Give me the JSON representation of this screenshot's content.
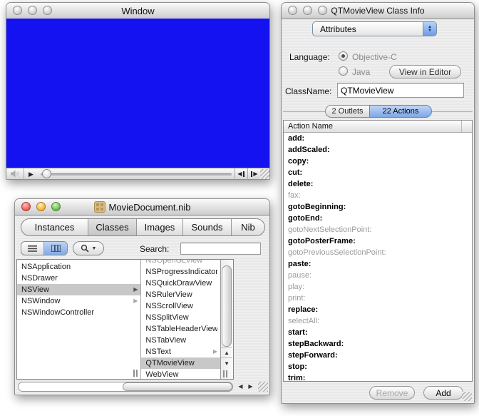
{
  "colors": {
    "movie_blue": "#1512f2",
    "selection_gray": "#c8c8c8",
    "selected_tab_blue": "#8fb3ec",
    "window_chrome": "#ececec"
  },
  "icons": {
    "play": "▶",
    "step_back_triangle": "◀",
    "step_fwd_triangle": "▶",
    "up_arrow": "▲",
    "down_arrow": "▼",
    "left_arrow": "◀",
    "right_arrow": "▶",
    "branch_arrow": "▶",
    "popup_up": "▲",
    "popup_down": "▼",
    "dropdown_arrow": "▼"
  },
  "movie_window": {
    "title": "Window"
  },
  "nib_window": {
    "title": "MovieDocument.nib",
    "tabs": [
      "Instances",
      "Classes",
      "Images",
      "Sounds",
      "Nib"
    ],
    "selected_tab": "Classes",
    "search_label": "Search:",
    "search_value": "",
    "browser": {
      "col1": [
        {
          "label": "NSApplication"
        },
        {
          "label": "NSDrawer"
        },
        {
          "label": "NSView",
          "selected": true,
          "has_children": true
        },
        {
          "label": "NSWindow",
          "has_children": true
        },
        {
          "label": "NSWindowController"
        }
      ],
      "col2_partial_top": "NSOpenGLView",
      "col2": [
        {
          "label": "NSProgressIndicator"
        },
        {
          "label": "NSQuickDrawView"
        },
        {
          "label": "NSRulerView"
        },
        {
          "label": "NSScrollView"
        },
        {
          "label": "NSSplitView"
        },
        {
          "label": "NSTableHeaderView"
        },
        {
          "label": "NSTabView"
        },
        {
          "label": "NSText",
          "has_children": true
        },
        {
          "label": "QTMovieView",
          "selected": true
        },
        {
          "label": "WebView"
        }
      ]
    }
  },
  "info_window": {
    "title": "QTMovieView Class Info",
    "popup_value": "Attributes",
    "language_label": "Language:",
    "radio_objective_c": "Objective-C",
    "radio_java": "Java",
    "selected_language": "Objective-C",
    "view_in_editor_label": "View in Editor",
    "classname_label": "ClassName:",
    "classname_value": "QTMovieView",
    "outlets_tab": "2 Outlets",
    "actions_tab": "22 Actions",
    "selected_info_tab": "22 Actions",
    "column_header": "Action Name",
    "actions": [
      {
        "name": "add:",
        "muted": false
      },
      {
        "name": "addScaled:",
        "muted": false
      },
      {
        "name": "copy:",
        "muted": false
      },
      {
        "name": "cut:",
        "muted": false
      },
      {
        "name": "delete:",
        "muted": false
      },
      {
        "name": "fax:",
        "muted": true
      },
      {
        "name": "gotoBeginning:",
        "muted": false
      },
      {
        "name": "gotoEnd:",
        "muted": false
      },
      {
        "name": "gotoNextSelectionPoint:",
        "muted": true
      },
      {
        "name": "gotoPosterFrame:",
        "muted": false
      },
      {
        "name": "gotoPreviousSelectionPoint:",
        "muted": true
      },
      {
        "name": "paste:",
        "muted": false
      },
      {
        "name": "pause:",
        "muted": true
      },
      {
        "name": "play:",
        "muted": true
      },
      {
        "name": "print:",
        "muted": true
      },
      {
        "name": "replace:",
        "muted": false
      },
      {
        "name": "selectAll:",
        "muted": true
      },
      {
        "name": "start:",
        "muted": false
      },
      {
        "name": "stepBackward:",
        "muted": false
      },
      {
        "name": "stepForward:",
        "muted": false
      },
      {
        "name": "stop:",
        "muted": false
      },
      {
        "name": "trim:",
        "muted": false
      }
    ],
    "remove_label": "Remove",
    "add_label": "Add"
  }
}
